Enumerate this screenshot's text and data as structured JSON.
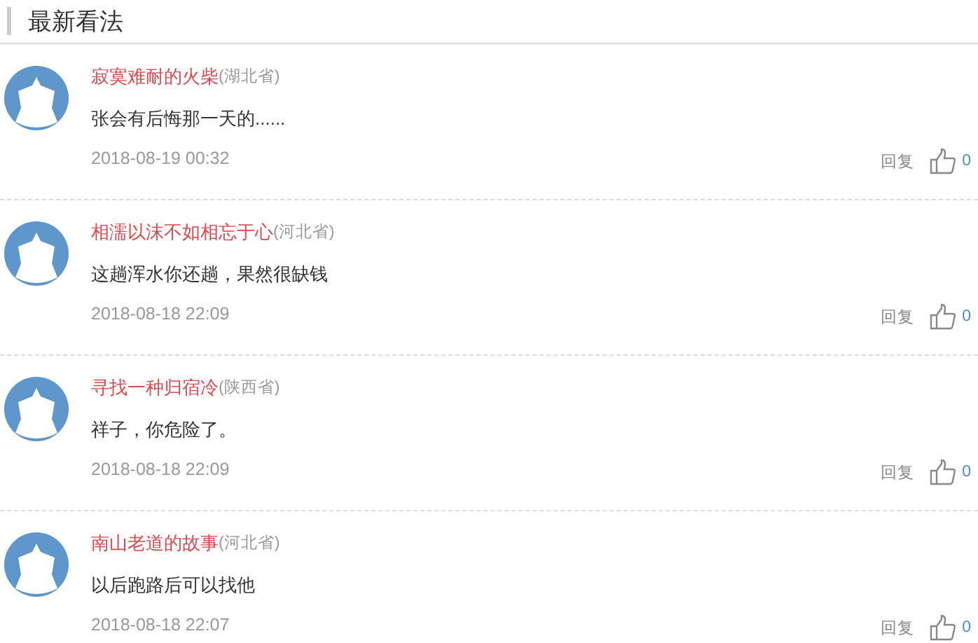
{
  "section": {
    "title": "最新看法"
  },
  "comments": [
    {
      "name": "寂寞难耐的火柴",
      "region": "(湖北省)",
      "text": "张会有后悔那一天的......",
      "time": "2018-08-19 00:32",
      "reply": "回复",
      "likes": "0"
    },
    {
      "name": "相濡以沫不如相忘于心",
      "region": "(河北省)",
      "text": "这趟浑水你还趟，果然很缺钱",
      "time": "2018-08-18 22:09",
      "reply": "回复",
      "likes": "0"
    },
    {
      "name": "寻找一种归宿冷",
      "region": "(陕西省)",
      "text": "祥子，你危险了。",
      "time": "2018-08-18 22:09",
      "reply": "回复",
      "likes": "0"
    },
    {
      "name": "南山老道的故事",
      "region": "(河北省)",
      "text": "以后跑路后可以找他",
      "time": "2018-08-18 22:07",
      "reply": "回复",
      "likes": "0"
    }
  ]
}
